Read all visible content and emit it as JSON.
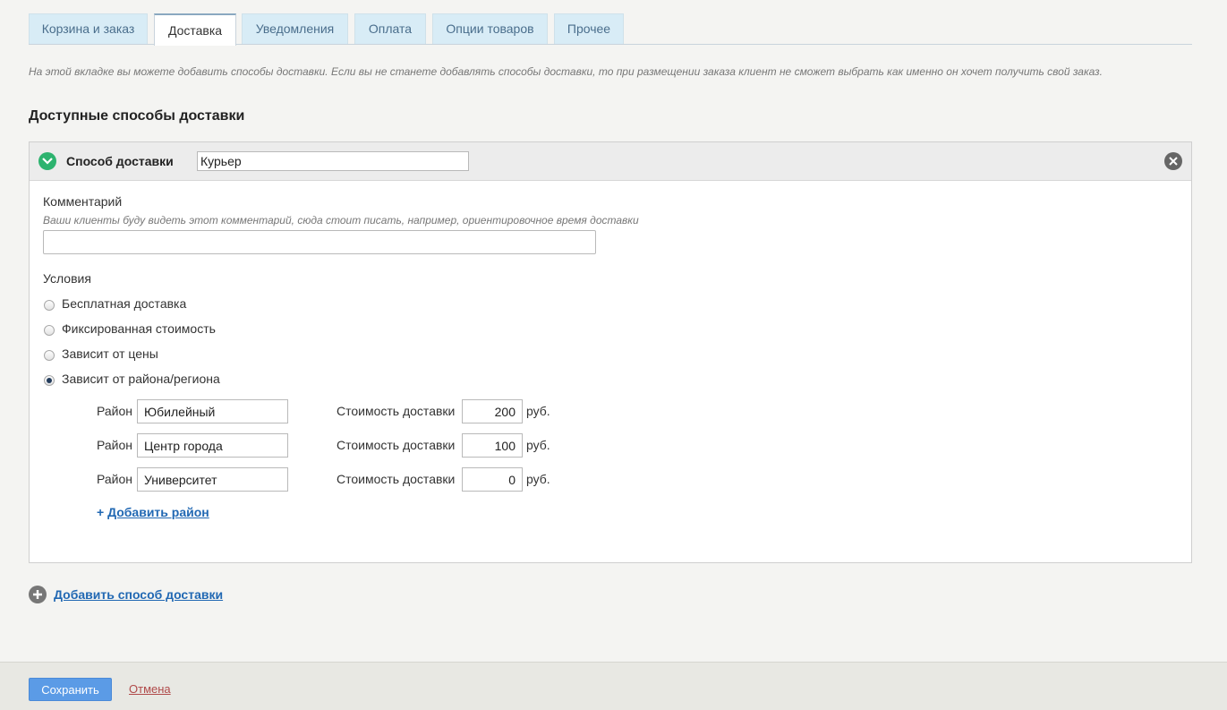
{
  "tabs": [
    {
      "label": "Корзина и заказ",
      "active": false
    },
    {
      "label": "Доставка",
      "active": true
    },
    {
      "label": "Уведомления",
      "active": false
    },
    {
      "label": "Оплата",
      "active": false
    },
    {
      "label": "Опции товаров",
      "active": false
    },
    {
      "label": "Прочее",
      "active": false
    }
  ],
  "intro": "На этой вкладке вы можете добавить способы доставки. Если вы не станете добавлять способы доставки, то при размещении заказа клиент не сможет выбрать как именно он хочет получить свой заказ.",
  "section_title": "Доступные способы доставки",
  "method": {
    "label": "Способ доставки",
    "name_value": "Курьер",
    "icons": {
      "status": "check-circle-icon",
      "remove": "close-circle-icon"
    },
    "comment_label": "Комментарий",
    "comment_hint": "Ваши клиенты буду видеть этот комментарий, сюда стоит писать, например, ориентировочное время доставки",
    "comment_value": "",
    "conditions_label": "Условия",
    "conditions": [
      {
        "label": "Бесплатная доставка",
        "checked": false
      },
      {
        "label": "Фиксированная стоимость",
        "checked": false
      },
      {
        "label": "Зависит от цены",
        "checked": false
      },
      {
        "label": "Зависит от района/региона",
        "checked": true
      }
    ],
    "zone_label": "Район",
    "cost_label": "Стоимость доставки",
    "currency": "руб.",
    "zones": [
      {
        "name": "Юбилейный",
        "cost": "200"
      },
      {
        "name": "Центр города",
        "cost": "100"
      },
      {
        "name": "Университет",
        "cost": "0"
      }
    ],
    "add_zone_plus": "+",
    "add_zone": "Добавить район"
  },
  "add_method": "Добавить способ доставки",
  "footer": {
    "save": "Сохранить",
    "cancel": "Отмена"
  },
  "colors": {
    "accent": "#2168b3",
    "save_button": "#5b9be6",
    "status_green": "#2db36f",
    "cancel": "#b04a4a"
  }
}
